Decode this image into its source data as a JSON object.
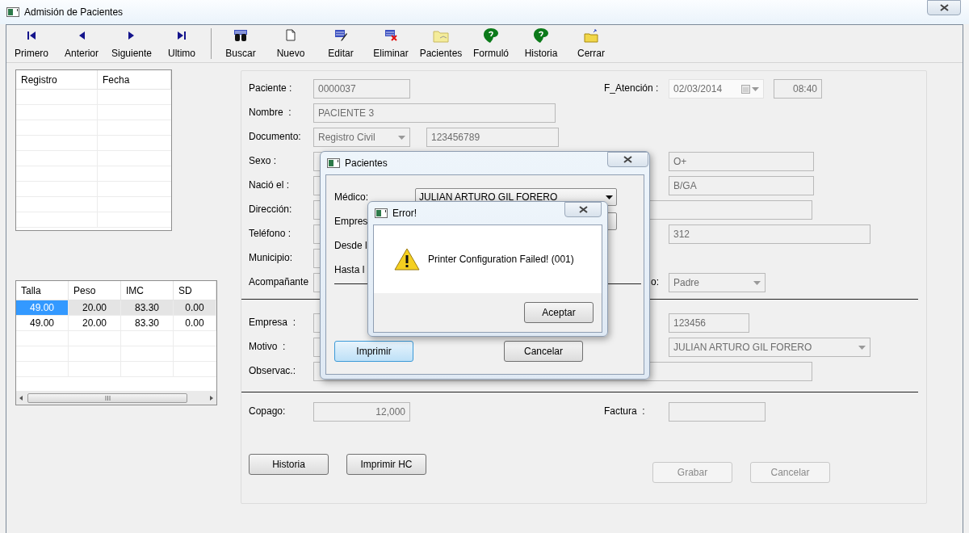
{
  "window": {
    "title": "Admisión de Pacientes"
  },
  "toolbar": [
    {
      "label": "Primero",
      "kind": "first"
    },
    {
      "label": "Anterior",
      "kind": "prev"
    },
    {
      "label": "Siguiente",
      "kind": "next"
    },
    {
      "label": "Ultimo",
      "kind": "last"
    },
    {
      "kind": "separator"
    },
    {
      "label": "Buscar",
      "kind": "search"
    },
    {
      "label": "Nuevo",
      "kind": "new"
    },
    {
      "label": "Editar",
      "kind": "edit"
    },
    {
      "label": "Eliminar",
      "kind": "delete"
    },
    {
      "label": "Pacientes",
      "kind": "folder"
    },
    {
      "label": "Formuló",
      "kind": "green"
    },
    {
      "label": "Historia",
      "kind": "green"
    },
    {
      "label": "Cerrar",
      "kind": "open"
    }
  ],
  "registros_table": {
    "columns": [
      "Registro",
      "Fecha"
    ]
  },
  "medidas_table": {
    "columns": [
      "Talla",
      "Peso",
      "IMC",
      "SD"
    ],
    "rows": [
      {
        "selected": true,
        "cells": [
          "49.00",
          "20.00",
          "83.30",
          "0.00"
        ]
      },
      {
        "selected": false,
        "cells": [
          "49.00",
          "20.00",
          "83.30",
          "0.00"
        ]
      }
    ]
  },
  "form": {
    "rows": [
      {
        "label": "Paciente :",
        "fields": [
          {
            "kind": "text",
            "value": "0000037"
          }
        ],
        "right_label": "F_Atención :",
        "right_fields": [
          {
            "kind": "date",
            "value": "02/03/2014"
          },
          {
            "kind": "time",
            "value": "08:40"
          }
        ]
      },
      {
        "label": "Nombre  :",
        "fields": [
          {
            "kind": "text",
            "value": "PACIENTE 3"
          }
        ]
      },
      {
        "label": "Documento:",
        "fields": [
          {
            "kind": "select",
            "value": "Registro Civil"
          },
          {
            "kind": "text",
            "value": "123456789"
          }
        ]
      },
      {
        "label": "Sexo :",
        "fields": [
          {
            "kind": "text"
          }
        ],
        "right_fields": [
          {
            "kind": "text",
            "value": "O+"
          }
        ]
      },
      {
        "label": "Nació el :",
        "fields": [
          {
            "kind": "text"
          }
        ],
        "right_fields": [
          {
            "kind": "text",
            "value": "B/GA"
          }
        ]
      },
      {
        "label": "Dirección:",
        "fields": [
          {
            "kind": "text"
          }
        ]
      },
      {
        "label": "Teléfono :",
        "fields": [
          {
            "kind": "text"
          }
        ],
        "right_fields": [
          {
            "kind": "text",
            "value": "312"
          }
        ]
      },
      {
        "label": "Municipio:",
        "fields": [
          {
            "kind": "text"
          }
        ]
      },
      {
        "label": "Acompañante",
        "fields": [
          {
            "kind": "text"
          }
        ],
        "right_label": "o:",
        "right_fields": [
          {
            "kind": "select",
            "value": "Padre"
          }
        ]
      },
      {
        "kind": "rule"
      },
      {
        "label": "Empresa  :",
        "fields": [
          {
            "kind": "text"
          }
        ],
        "right_fields": [
          {
            "kind": "text",
            "value": "123456"
          }
        ]
      },
      {
        "label": "Motivo  :",
        "fields": [
          {
            "kind": "text"
          }
        ],
        "right_fields": [
          {
            "kind": "select",
            "value": "JULIAN ARTURO GIL FORERO"
          }
        ]
      },
      {
        "label": "Observac.:",
        "fields": [
          {
            "kind": "text"
          }
        ]
      },
      {
        "kind": "rule"
      },
      {
        "label": "Copago:",
        "fields": [
          {
            "kind": "number",
            "value": "12,000"
          }
        ],
        "right_label": "Factura  :",
        "right_fields": [
          {
            "kind": "text"
          }
        ]
      }
    ],
    "left_buttons": [
      {
        "label": "Historia",
        "disabled": false
      },
      {
        "label": "Imprimir HC",
        "disabled": false
      }
    ],
    "right_buttons": [
      {
        "label": "Grabar",
        "disabled": true
      },
      {
        "label": "Cancelar",
        "disabled": true
      }
    ]
  },
  "pacientes_dialog": {
    "title": "Pacientes",
    "rows": [
      {
        "kind": "select",
        "label": "Médico:",
        "value": "JULIAN ARTURO GIL FORERO"
      },
      {
        "kind": "select",
        "label": "Empres"
      },
      {
        "kind": "label",
        "label": "Desde l"
      },
      {
        "kind": "label",
        "label": "Hasta l"
      }
    ],
    "buttons": [
      {
        "label": "Imprimir",
        "focused": true
      },
      {
        "label": "Cancelar",
        "focused": false
      }
    ]
  },
  "error_dialog": {
    "title": "Error!",
    "message": "Printer Configuration Failed! (001)",
    "button": "Aceptar"
  }
}
